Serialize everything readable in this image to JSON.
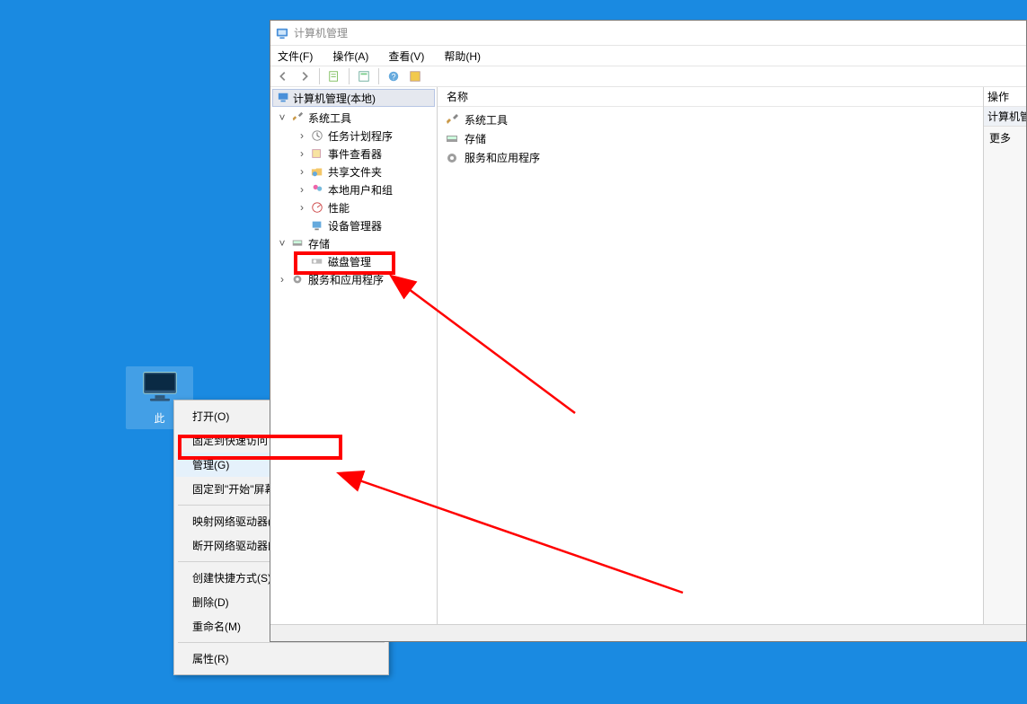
{
  "desktop_icon": {
    "label": "此"
  },
  "context_menu": {
    "open": "打开(O)",
    "pin_qa": "固定到快速访问",
    "manage": "管理(G)",
    "pin_start": "固定到\"开始\"屏幕(P)",
    "map_drive": "映射网络驱动器(N)...",
    "disconnect_drive": "断开网络驱动器的连接(C)...",
    "create_shortcut": "创建快捷方式(S)",
    "delete": "删除(D)",
    "rename": "重命名(M)",
    "properties": "属性(R)"
  },
  "window": {
    "title": "计算机管理",
    "menu": {
      "file": "文件(F)",
      "action": "操作(A)",
      "view": "查看(V)",
      "help": "帮助(H)"
    },
    "tree": {
      "root": "计算机管理(本地)",
      "system_tools": "系统工具",
      "task_scheduler": "任务计划程序",
      "event_viewer": "事件查看器",
      "shared_folders": "共享文件夹",
      "local_users": "本地用户和组",
      "performance": "性能",
      "device_manager": "设备管理器",
      "storage": "存储",
      "disk_management": "磁盘管理",
      "services_apps": "服务和应用程序"
    },
    "list_header": "名称",
    "list": {
      "system_tools": "系统工具",
      "storage": "存储",
      "services_apps": "服务和应用程序"
    },
    "action_pane": {
      "header": "操作",
      "group": "计算机管",
      "more": "更多"
    }
  }
}
